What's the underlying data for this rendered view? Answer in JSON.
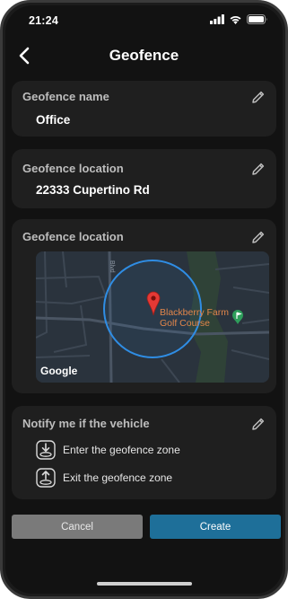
{
  "status_bar": {
    "time": "21:24"
  },
  "header": {
    "title": "Geofence"
  },
  "name_card": {
    "label": "Geofence name",
    "value": "Office"
  },
  "location_card": {
    "label": "Geofence location",
    "value": "22333 Cupertino Rd"
  },
  "map_card": {
    "label": "Geofence location",
    "map_provider": "Google",
    "poi_line1": "Blackberry Farm",
    "poi_line2": "Golf Course",
    "road_label": "Blvd"
  },
  "notify_card": {
    "label": "Notify me if the vehicle",
    "options": [
      {
        "label": "Enter the geofence zone",
        "icon": "enter-zone-icon"
      },
      {
        "label": "Exit the geofence zone",
        "icon": "exit-zone-icon"
      }
    ]
  },
  "actions": {
    "cancel_label": "Cancel",
    "create_label": "Create"
  },
  "colors": {
    "background": "#121212",
    "card": "#1f1f1f",
    "accent": "#1e6f99",
    "geofence_circle": "#2f8de4",
    "pin": "#e53935",
    "cancel": "#7a7a7a"
  }
}
